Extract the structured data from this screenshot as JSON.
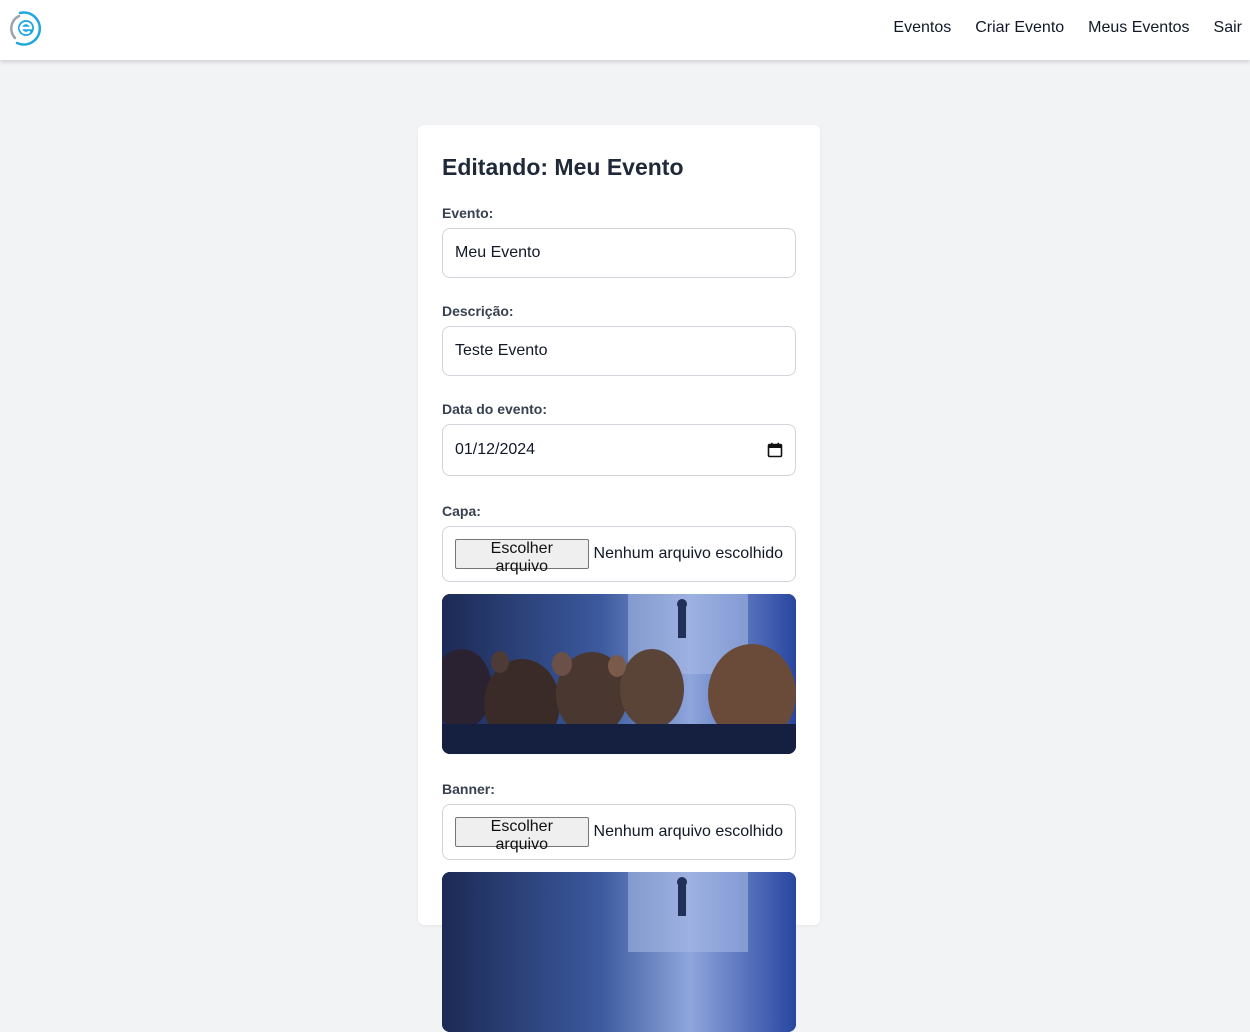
{
  "nav": {
    "logo_icon": "event-logo-icon",
    "links": [
      "Eventos",
      "Criar Evento",
      "Meus Eventos",
      "Sair"
    ]
  },
  "form": {
    "title": "Editando: Meu Evento",
    "event": {
      "label": "Evento:",
      "value": "Meu Evento"
    },
    "description": {
      "label": "Descrição:",
      "value": "Teste Evento"
    },
    "date": {
      "label": "Data do evento:",
      "value": "01/12/2024",
      "icon": "calendar-icon"
    },
    "cover": {
      "label": "Capa:",
      "button": "Escolher arquivo",
      "status": "Nenhum arquivo escolhido",
      "preview_icon": "conference-photo"
    },
    "banner": {
      "label": "Banner:",
      "button": "Escolher arquivo",
      "status": "Nenhum arquivo escolhido",
      "preview_icon": "conference-photo"
    }
  },
  "colors": {
    "accent": "#1ea7e1",
    "page_bg": "#f2f3f5",
    "card_bg": "#ffffff",
    "border": "#d1d5db"
  }
}
